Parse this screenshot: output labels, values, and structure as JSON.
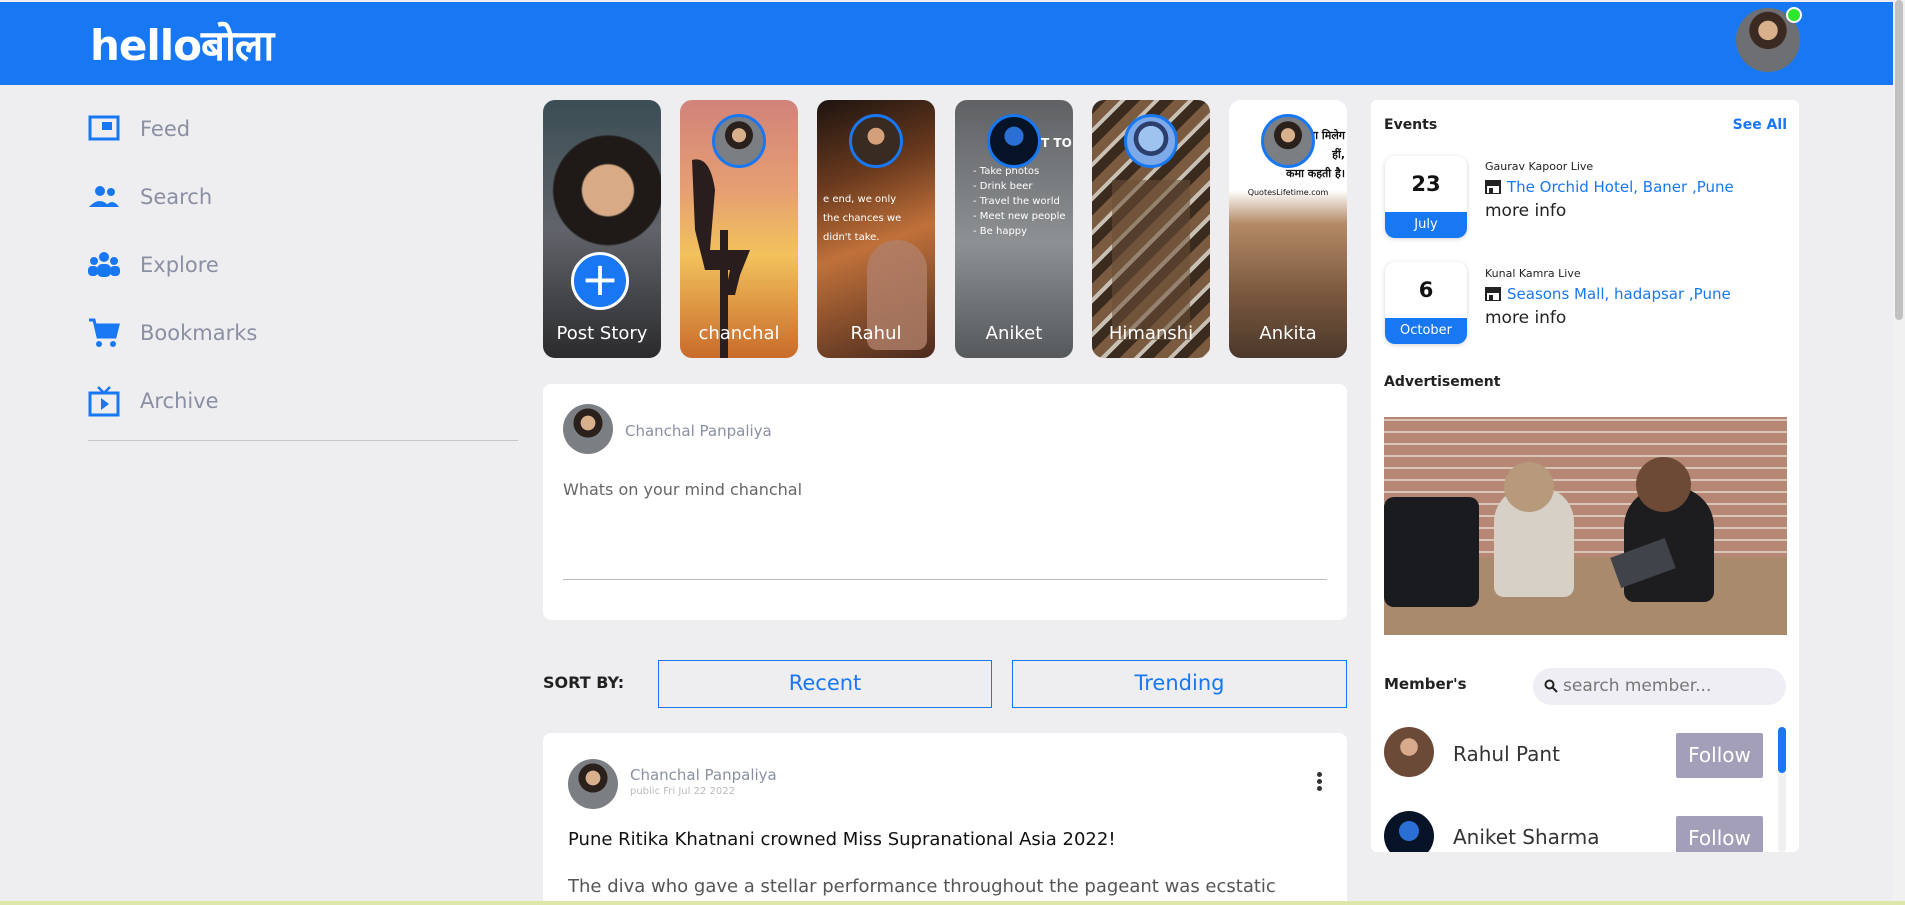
{
  "header": {
    "logo": "helloबोला"
  },
  "sidebar": {
    "items": [
      {
        "label": "Feed",
        "icon": "feed-icon"
      },
      {
        "label": "Search",
        "icon": "people-icon"
      },
      {
        "label": "Explore",
        "icon": "group-icon"
      },
      {
        "label": "Bookmarks",
        "icon": "cart-icon"
      },
      {
        "label": "Archive",
        "icon": "tv-icon"
      }
    ]
  },
  "stories": [
    {
      "name": "Post Story"
    },
    {
      "name": "chanchal"
    },
    {
      "name": "Rahul"
    },
    {
      "name": "Aniket"
    },
    {
      "name": "Himanshi"
    },
    {
      "name": "Ankita"
    }
  ],
  "story_texts": {
    "rahul": [
      "e end, we only",
      "the chances we",
      "didn't take."
    ],
    "aniket_title": "WANT TO",
    "aniket": [
      "- Take photos",
      "- Drink beer",
      "- Travel the world",
      "- Meet new people",
      "- Be happy"
    ],
    "ankita": [
      "सा मिलेग",
      "हीं,",
      "कमा कहती है।",
      "QuotesLifetime.com"
    ]
  },
  "composer": {
    "user": "Chanchal Panpaliya",
    "placeholder": "Whats on your mind chanchal"
  },
  "sort": {
    "label": "SORT BY:",
    "options": [
      "Recent",
      "Trending"
    ]
  },
  "post": {
    "author": "Chanchal Panpaliya",
    "meta": "public Fri Jul 22 2022",
    "title": "Pune Ritika Khatnani crowned Miss Supranational Asia 2022!",
    "body": "The diva who gave a stellar performance throughout the pageant was ecstatic"
  },
  "events": {
    "title": "Events",
    "see_all": "See All",
    "items": [
      {
        "day": "23",
        "month": "July",
        "name": "Gaurav Kapoor Live",
        "venue": "The Orchid Hotel, Baner ,Pune",
        "more": "more info"
      },
      {
        "day": "6",
        "month": "October",
        "name": "Kunal Kamra Live",
        "venue": "Seasons Mall, hadapsar ,Pune",
        "more": "more info"
      }
    ]
  },
  "advertisement": {
    "title": "Advertisement"
  },
  "members": {
    "title": "Member's",
    "search_placeholder": "search member...",
    "items": [
      {
        "name": "Rahul Pant",
        "action": "Follow"
      },
      {
        "name": "Aniket Sharma",
        "action": "Follow"
      }
    ]
  },
  "colors": {
    "brand": "#1877f2",
    "follow": "#a49fb9",
    "muted": "#8a8fa4"
  }
}
